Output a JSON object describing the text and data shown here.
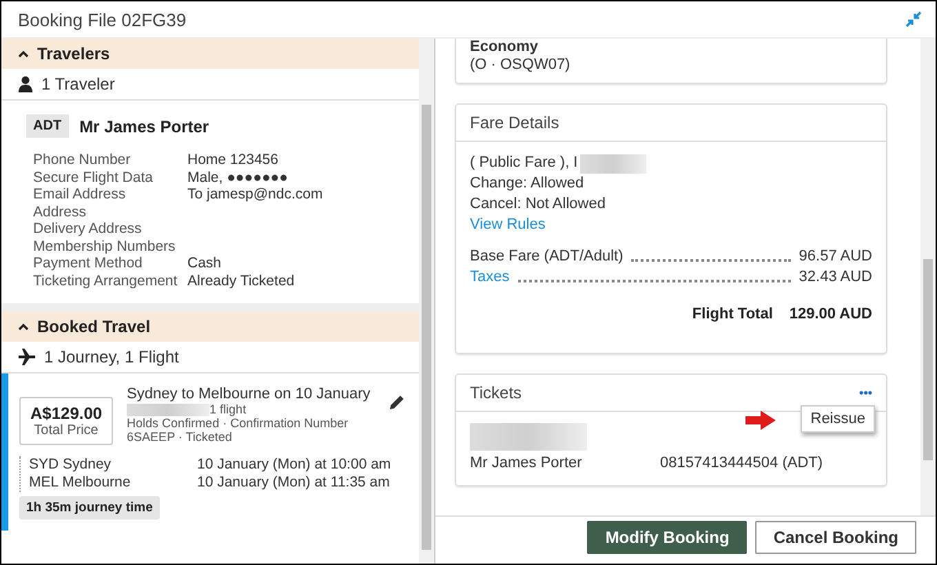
{
  "window": {
    "title": "Booking File 02FG39"
  },
  "travelers": {
    "title": "Travelers",
    "expanded": true,
    "summary": "1 Traveler",
    "traveler": {
      "type": "ADT",
      "name": "Mr James Porter",
      "fields": [
        {
          "label": "Phone Number",
          "value": "Home 123456"
        },
        {
          "label": "Secure Flight Data",
          "value": "Male, ●●●●●●●"
        },
        {
          "label": "Email Address",
          "value": "To jamesp@ndc.com"
        },
        {
          "label": "Address"
        },
        {
          "label": "Delivery Address"
        },
        {
          "label": "Membership Numbers"
        },
        {
          "label": "Payment Method",
          "value": "Cash"
        },
        {
          "label": "Ticketing Arrangement",
          "value": "Already Ticketed"
        }
      ]
    }
  },
  "booked_travel": {
    "title": "Booked Travel",
    "expanded": true,
    "summary": "1 Journey, 1 Flight",
    "journey": {
      "price": "A$129.00",
      "price_label": "Total Price",
      "title": "Sydney to Melbourne on 10 January",
      "flights": "1 flight",
      "status": "Holds Confirmed · Confirmation Number 6SAEEP · Ticketed",
      "stops": [
        {
          "place": "SYD Sydney",
          "time": "10 January (Mon) at 10:00 am"
        },
        {
          "place": "MEL Melbourne",
          "time": "10 January (Mon) at 11:35 am"
        }
      ],
      "duration": "1h 35m journey time"
    }
  },
  "cabin": {
    "class": "Economy",
    "code": "(O · OSQW07)"
  },
  "fare_details": {
    "title": "Fare Details",
    "fare_type": "( Public Fare ), I",
    "change": "Change: Allowed",
    "cancel": "Cancel: Not Allowed",
    "rules_link": "View Rules",
    "lines": [
      {
        "label": "Base Fare (ADT/Adult)",
        "amount": "96.57 AUD",
        "kind": "text"
      },
      {
        "label": "Taxes",
        "amount": "32.43 AUD",
        "kind": "link"
      }
    ],
    "total_label": "Flight Total",
    "total": "129.00 AUD"
  },
  "tickets": {
    "title": "Tickets",
    "menu_button": "•••",
    "menu": [
      "Reissue"
    ],
    "passenger": "Mr James Porter",
    "number": "08157413444504 (ADT)"
  },
  "buttons": [
    {
      "label": "Modify Booking",
      "kind": "primary"
    },
    {
      "label": "Cancel Booking",
      "kind": "secondary"
    }
  ]
}
